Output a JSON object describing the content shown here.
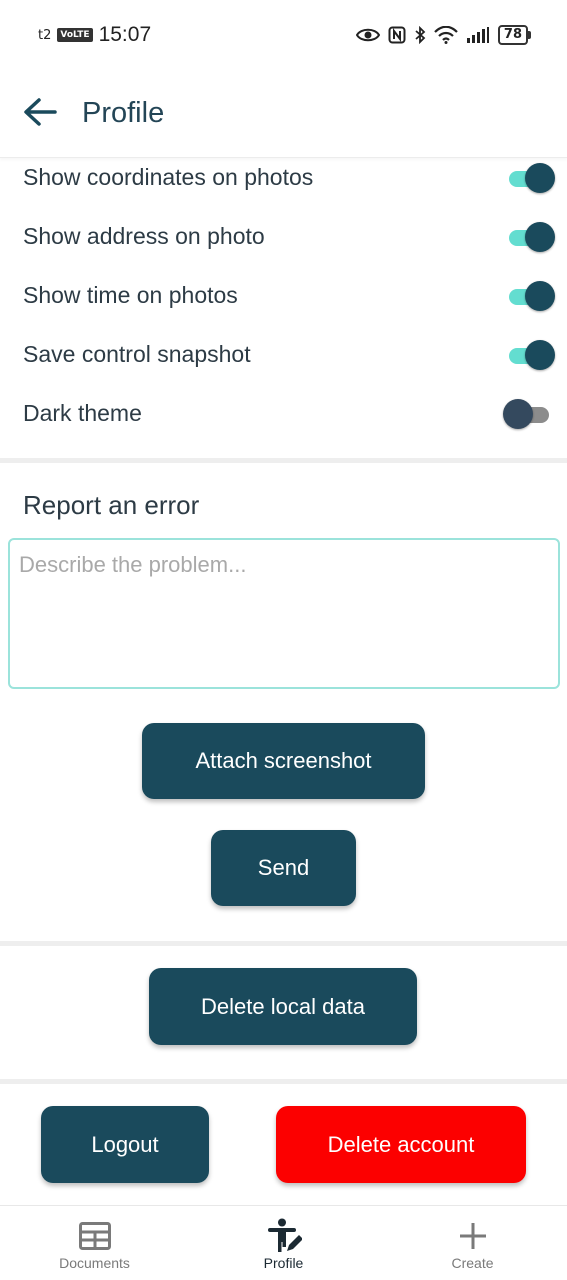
{
  "status_bar": {
    "carrier": "t2",
    "volte": "VoLTE",
    "time": "15:07",
    "battery": "78"
  },
  "app_bar": {
    "title": "Profile",
    "back_icon": "arrow-left-icon"
  },
  "toggles": [
    {
      "label": "Show coordinates on photos",
      "on": true
    },
    {
      "label": "Show address on photo",
      "on": true
    },
    {
      "label": "Show time on photos",
      "on": true
    },
    {
      "label": "Save control snapshot",
      "on": true
    },
    {
      "label": "Dark theme",
      "on": false
    }
  ],
  "report": {
    "title": "Report an error",
    "placeholder": "Describe the problem...",
    "value": "",
    "attach_label": "Attach screenshot",
    "send_label": "Send"
  },
  "data_actions": {
    "delete_local_label": "Delete local data"
  },
  "account": {
    "logout_label": "Logout",
    "delete_account_label": "Delete account"
  },
  "bottom_nav": [
    {
      "label": "Documents",
      "icon": "grid-icon",
      "active": false
    },
    {
      "label": "Profile",
      "icon": "person-edit-icon",
      "active": true
    },
    {
      "label": "Create",
      "icon": "plus-icon",
      "active": false
    }
  ],
  "colors": {
    "primary": "#1a4a5c",
    "accent": "#63ddd0",
    "danger": "#fc0000"
  }
}
